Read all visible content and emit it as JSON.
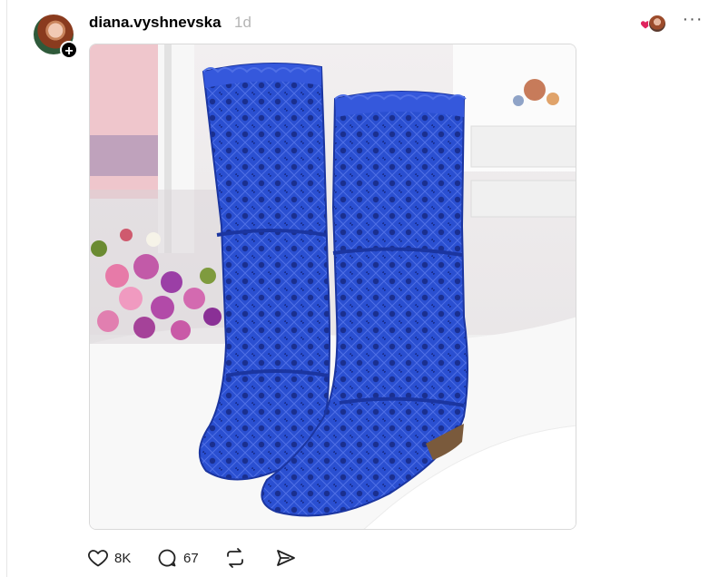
{
  "post": {
    "author": "diana.vyshnevska",
    "time_ago": "1d",
    "follow_symbol": "+",
    "more_symbol": "···"
  },
  "image": {
    "subject": "blue crochet lace knee-high boots",
    "colors": {
      "boot": "#2a4fd1",
      "boot_shadow": "#1b35a0",
      "background": "#ece9ea",
      "floor": "#f7f7f7"
    }
  },
  "actions": {
    "like_count": "8K",
    "reply_count": "67"
  },
  "icons": [
    "follow-plus-icon",
    "heart-icon",
    "reply-icon",
    "repost-icon",
    "share-icon",
    "more-icon"
  ],
  "colors": {
    "text": "#000000",
    "muted": "#b5b5b5",
    "heart": "#e0245e",
    "divider": "#e6e6e6"
  }
}
